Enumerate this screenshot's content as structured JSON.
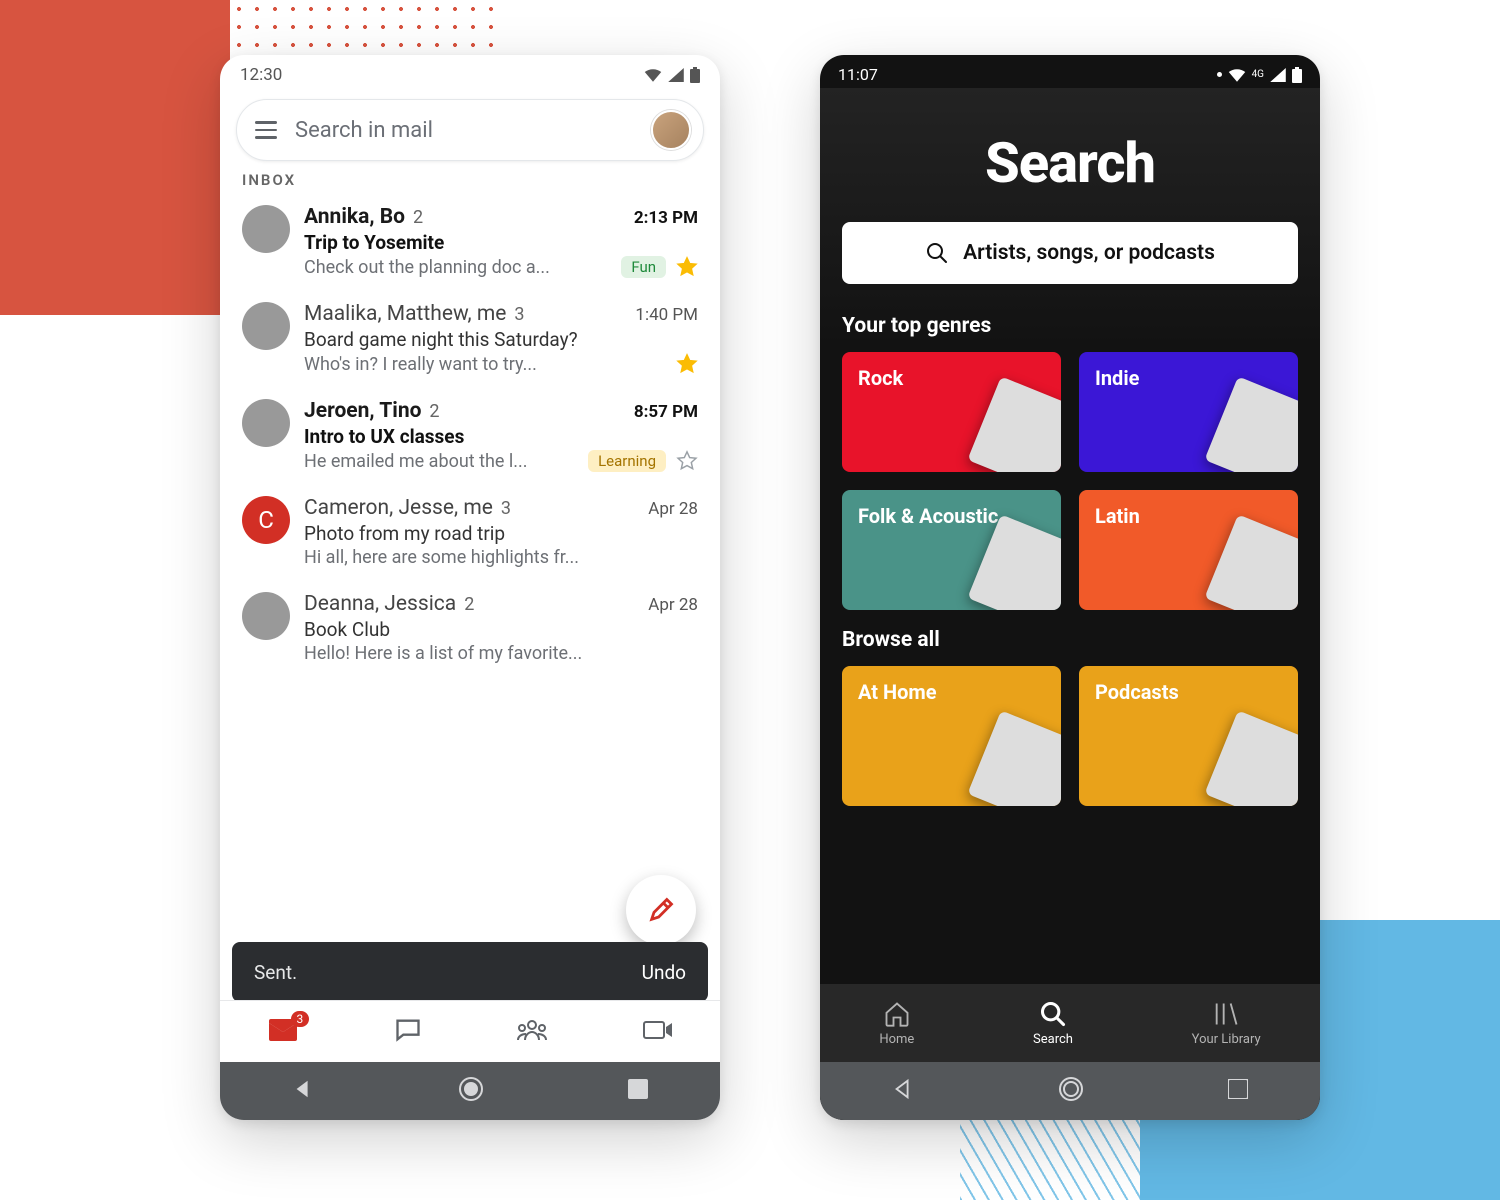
{
  "gmail": {
    "status_time": "12:30",
    "search_placeholder": "Search in mail",
    "section_label": "INBOX",
    "threads": [
      {
        "senders": "Annika, Bo",
        "count": "2",
        "time": "2:13 PM",
        "subject": "Trip to Yosemite",
        "snippet": "Check out the planning doc a...",
        "chip": "Fun",
        "chip_kind": "fun",
        "unread": true,
        "starred": true,
        "avatar": "av1",
        "letter": ""
      },
      {
        "senders": "Maalika, Matthew, me",
        "count": "3",
        "time": "1:40 PM",
        "subject": "Board game night this Saturday?",
        "snippet": "Who's in? I really want to try...",
        "chip": "",
        "chip_kind": "",
        "unread": false,
        "starred": true,
        "avatar": "av2",
        "letter": ""
      },
      {
        "senders": "Jeroen, Tino",
        "count": "2",
        "time": "8:57 PM",
        "subject": "Intro to UX classes",
        "snippet": "He emailed me about the l...",
        "chip": "Learning",
        "chip_kind": "learning",
        "unread": true,
        "starred": false,
        "avatar": "av3",
        "letter": ""
      },
      {
        "senders": "Cameron, Jesse, me",
        "count": "3",
        "time": "Apr 28",
        "subject": "Photo from my road trip",
        "snippet": "Hi all, here are some highlights fr...",
        "chip": "",
        "chip_kind": "",
        "unread": false,
        "starred": null,
        "avatar": "letter",
        "letter": "C"
      },
      {
        "senders": "Deanna, Jessica",
        "count": "2",
        "time": "Apr 28",
        "subject": "Book Club",
        "snippet": "Hello! Here is a list of my favorite...",
        "chip": "",
        "chip_kind": "",
        "unread": false,
        "starred": null,
        "avatar": "av5",
        "letter": ""
      }
    ],
    "snackbar": {
      "message": "Sent.",
      "action": "Undo"
    },
    "badge_count": "3"
  },
  "spotify": {
    "status_time": "11:07",
    "network_label": "4G",
    "title": "Search",
    "search_placeholder": "Artists, songs, or podcasts",
    "top_genres_label": "Your top genres",
    "browse_all_label": "Browse all",
    "genres": [
      {
        "label": "Rock",
        "color": "#e8132a"
      },
      {
        "label": "Indie",
        "color": "#3b17d6"
      },
      {
        "label": "Folk & Acoustic",
        "color": "#4a9388"
      },
      {
        "label": "Latin",
        "color": "#f15a29"
      }
    ],
    "browse": [
      {
        "label": "At Home",
        "color": "#e9a21a"
      },
      {
        "label": "Podcasts",
        "color": "#e9a21a"
      }
    ],
    "tabs": {
      "home": "Home",
      "search": "Search",
      "library": "Your Library"
    }
  }
}
